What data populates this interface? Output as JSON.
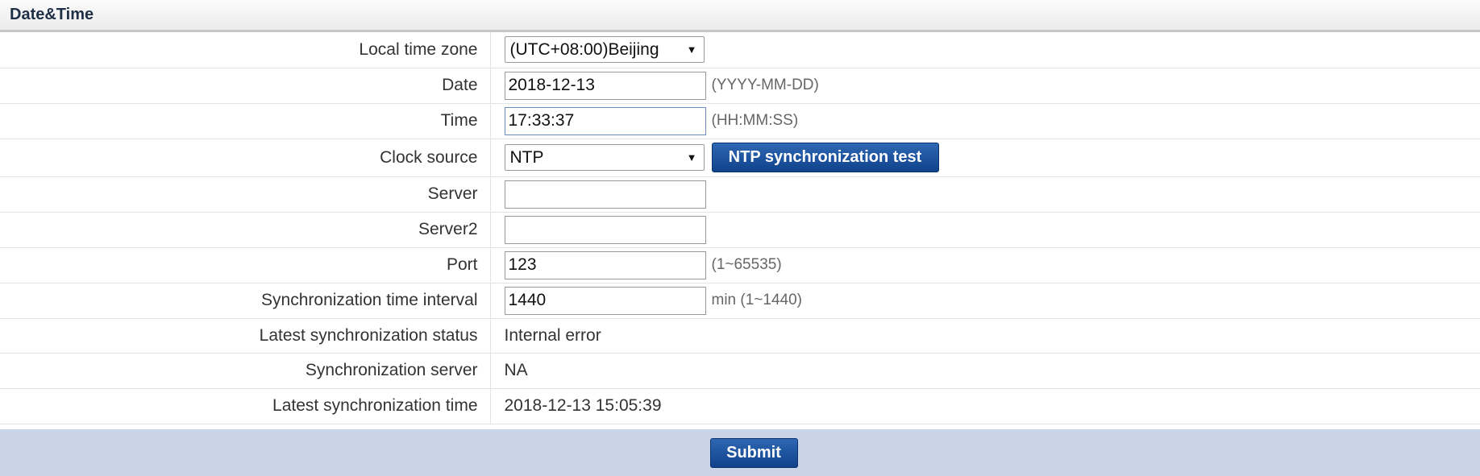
{
  "header": {
    "title": "Date&Time"
  },
  "form": {
    "timezone": {
      "label": "Local time zone",
      "value": "(UTC+08:00)Beijing"
    },
    "date": {
      "label": "Date",
      "value": "2018-12-13",
      "hint": "(YYYY-MM-DD)"
    },
    "time": {
      "label": "Time",
      "value": "17:33:37",
      "hint": "(HH:MM:SS)"
    },
    "clock_source": {
      "label": "Clock source",
      "value": "NTP",
      "test_button": "NTP synchronization test"
    },
    "server": {
      "label": "Server",
      "value": ""
    },
    "server2": {
      "label": "Server2",
      "value": ""
    },
    "port": {
      "label": "Port",
      "value": "123",
      "hint": "(1~65535)"
    },
    "interval": {
      "label": "Synchronization time interval",
      "value": "1440",
      "hint": "min (1~1440)"
    },
    "status": {
      "label": "Latest synchronization status",
      "value": "Internal error"
    },
    "sync_server": {
      "label": "Synchronization server",
      "value": "NA"
    },
    "sync_time": {
      "label": "Latest synchronization time",
      "value": "2018-12-13 15:05:39"
    }
  },
  "footer": {
    "submit_label": "Submit"
  },
  "colors": {
    "button": "#1a4f9c",
    "footer_bg": "#c9d5e6"
  },
  "icons": {
    "dropdown": "dropdown-arrow-icon"
  }
}
